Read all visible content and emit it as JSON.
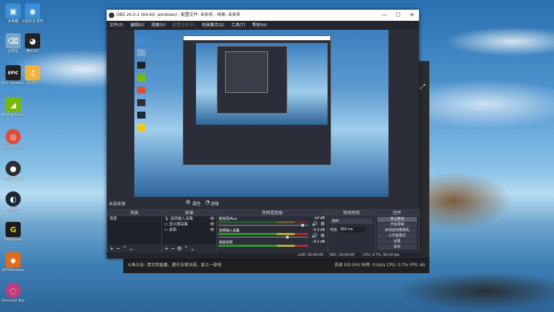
{
  "desktop": {
    "icons": [
      {
        "label": "此电脑",
        "glyph": "▣",
        "color": "#3b8fd6"
      },
      {
        "label": "火绒安全\n软件",
        "glyph": "◉",
        "color": "#e8612c"
      },
      {
        "label": "回收站",
        "glyph": "🗑",
        "color": "#7aa7c7"
      },
      {
        "label": "Epic Games\nLauncher",
        "glyph": "EPIC",
        "color": "#222222"
      },
      {
        "label": "NVIDIA\nExperience",
        "glyph": "◢",
        "color": "#76b900"
      },
      {
        "label": "Google\nChrome",
        "glyph": "◎",
        "color": "#dd4b39"
      },
      {
        "label": "OBS Studio",
        "glyph": "●",
        "color": "#302e31"
      },
      {
        "label": "Steam",
        "glyph": "◐",
        "color": "#1b2838"
      },
      {
        "label": "GWindows",
        "glyph": "G",
        "color": "#f5c518"
      },
      {
        "label": "GPUWindows",
        "glyph": "◆",
        "color": "#e06a1b"
      },
      {
        "label": "Uninstall\nTool",
        "glyph": "◌",
        "color": "#c33b7a"
      },
      {
        "label": "腾讯QQ",
        "glyph": "◕",
        "color": "#222222"
      },
      {
        "label": "QQ音乐",
        "glyph": "♫",
        "color": "#f2b33d"
      }
    ]
  },
  "obs": {
    "window_title": "OBS 26.0.2 (64-bit, windows) - 配置文件: 未命名 - 场景: 未命名",
    "menu": [
      "文件(F)",
      "编辑(E)",
      "视图(V)",
      "配置文件(P)",
      "场景集合(S)",
      "工具(T)",
      "帮助(H)"
    ],
    "no_source_label": "未选择源",
    "props_label": "属性",
    "filters_label": "滤镜",
    "docks": {
      "scenes": {
        "title": "场景",
        "items": [
          "场景"
        ]
      },
      "sources": {
        "title": "来源",
        "items": [
          "音频输入采集",
          "显示器采集",
          "桌面"
        ]
      },
      "mixer": {
        "title": "音频混音器",
        "channels": [
          {
            "name": "麦克风/Aux",
            "db": "-inf dB"
          },
          {
            "name": "音频输入采集",
            "db": "-3.3 dB"
          },
          {
            "name": "桌面音频",
            "db": "-4.1 dB"
          }
        ]
      },
      "transitions": {
        "title": "转场特效",
        "type": "淡出",
        "duration_label": "时长",
        "duration": "300 ms"
      },
      "controls": {
        "title": "控件",
        "buttons": [
          "停止推流",
          "开始录制",
          "启动虚拟摄像机",
          "工作室模式",
          "设置",
          "退出"
        ]
      }
    },
    "status": {
      "live": "LIVE: 00:00:00",
      "rec": "REC: 00:00:00",
      "cpu": "CPU: 0.7%, 60.00 fps"
    }
  },
  "background_window": {
    "footer_text": "斗鱼公告: 请文明直播，遵守法律法规，爱上一部电",
    "footer_stats": "丢帧 0(0.0%)  码率: 0 kb/s  CPU: 0.7%  FPS: 60"
  }
}
